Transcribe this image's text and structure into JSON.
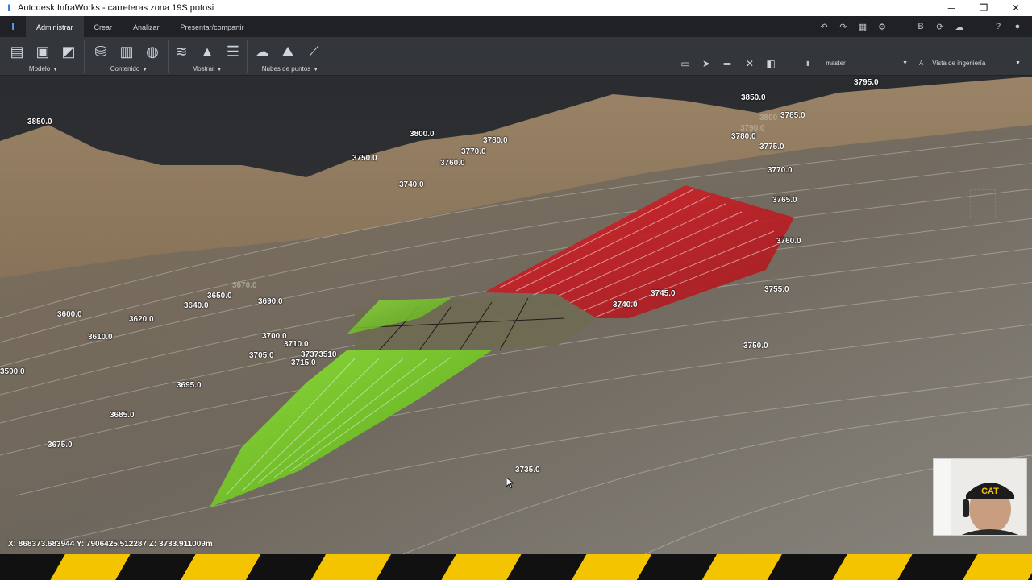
{
  "window": {
    "title": "Autodesk InfraWorks - carreteras zona 19S potosi",
    "app_icon": "I",
    "minimize": "─",
    "restore": "❐",
    "close": "✕"
  },
  "tabs": [
    {
      "label": "Administrar",
      "active": true
    },
    {
      "label": "Crear",
      "active": false
    },
    {
      "label": "Analizar",
      "active": false
    },
    {
      "label": "Presentar/compartir",
      "active": false
    }
  ],
  "ribbon": {
    "groups": [
      {
        "label": "Modelo"
      },
      {
        "label": "Contenido"
      },
      {
        "label": "Mostrar"
      },
      {
        "label": "Nubes de puntos"
      }
    ],
    "proposal_dropdown": "master",
    "view_dropdown": "Vista de ingeniería"
  },
  "colors": {
    "cut_slope": "#c81f24",
    "fill_slope": "#7ecf2a",
    "road_surface": "#6f6b52",
    "accent": "#4ca3ff"
  },
  "elevation_labels": [
    "3850.0",
    "3800.0",
    "3780.0",
    "3770.0",
    "3760.0",
    "3750.0",
    "3740.0",
    "3850.0",
    "3795.0",
    "3800",
    "3785.0",
    "3790.0",
    "3780.0",
    "3775.0",
    "3770.0",
    "3765.0",
    "3760.0",
    "3755.0",
    "3745.0",
    "3740.0",
    "3750.0",
    "3735.0",
    "3670.0",
    "3650.0",
    "3640.0",
    "3690.0",
    "3600.0",
    "3620.0",
    "3610.0",
    "3700.0",
    "3710.0",
    "3705.0",
    "3715.0",
    "37373510",
    "3590.0",
    "3695.0",
    "3685.0",
    "3675.0"
  ],
  "status": {
    "coordinates": "X: 868373.683944 Y: 7906425.512287 Z: 3733.911009m"
  },
  "webcam": {
    "cap_text": "CAT"
  }
}
